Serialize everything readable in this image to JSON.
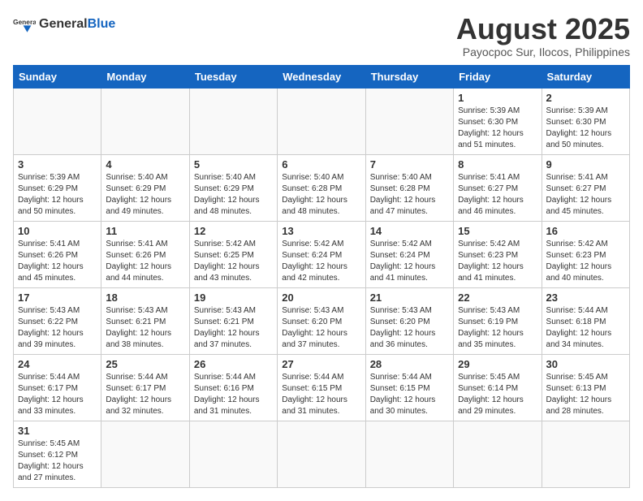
{
  "logo": {
    "text_general": "General",
    "text_blue": "Blue"
  },
  "title": "August 2025",
  "subtitle": "Payocpoc Sur, Ilocos, Philippines",
  "weekdays": [
    "Sunday",
    "Monday",
    "Tuesday",
    "Wednesday",
    "Thursday",
    "Friday",
    "Saturday"
  ],
  "weeks": [
    [
      {
        "day": "",
        "info": ""
      },
      {
        "day": "",
        "info": ""
      },
      {
        "day": "",
        "info": ""
      },
      {
        "day": "",
        "info": ""
      },
      {
        "day": "",
        "info": ""
      },
      {
        "day": "1",
        "info": "Sunrise: 5:39 AM\nSunset: 6:30 PM\nDaylight: 12 hours and 51 minutes."
      },
      {
        "day": "2",
        "info": "Sunrise: 5:39 AM\nSunset: 6:30 PM\nDaylight: 12 hours and 50 minutes."
      }
    ],
    [
      {
        "day": "3",
        "info": "Sunrise: 5:39 AM\nSunset: 6:29 PM\nDaylight: 12 hours and 50 minutes."
      },
      {
        "day": "4",
        "info": "Sunrise: 5:40 AM\nSunset: 6:29 PM\nDaylight: 12 hours and 49 minutes."
      },
      {
        "day": "5",
        "info": "Sunrise: 5:40 AM\nSunset: 6:29 PM\nDaylight: 12 hours and 48 minutes."
      },
      {
        "day": "6",
        "info": "Sunrise: 5:40 AM\nSunset: 6:28 PM\nDaylight: 12 hours and 48 minutes."
      },
      {
        "day": "7",
        "info": "Sunrise: 5:40 AM\nSunset: 6:28 PM\nDaylight: 12 hours and 47 minutes."
      },
      {
        "day": "8",
        "info": "Sunrise: 5:41 AM\nSunset: 6:27 PM\nDaylight: 12 hours and 46 minutes."
      },
      {
        "day": "9",
        "info": "Sunrise: 5:41 AM\nSunset: 6:27 PM\nDaylight: 12 hours and 45 minutes."
      }
    ],
    [
      {
        "day": "10",
        "info": "Sunrise: 5:41 AM\nSunset: 6:26 PM\nDaylight: 12 hours and 45 minutes."
      },
      {
        "day": "11",
        "info": "Sunrise: 5:41 AM\nSunset: 6:26 PM\nDaylight: 12 hours and 44 minutes."
      },
      {
        "day": "12",
        "info": "Sunrise: 5:42 AM\nSunset: 6:25 PM\nDaylight: 12 hours and 43 minutes."
      },
      {
        "day": "13",
        "info": "Sunrise: 5:42 AM\nSunset: 6:24 PM\nDaylight: 12 hours and 42 minutes."
      },
      {
        "day": "14",
        "info": "Sunrise: 5:42 AM\nSunset: 6:24 PM\nDaylight: 12 hours and 41 minutes."
      },
      {
        "day": "15",
        "info": "Sunrise: 5:42 AM\nSunset: 6:23 PM\nDaylight: 12 hours and 41 minutes."
      },
      {
        "day": "16",
        "info": "Sunrise: 5:42 AM\nSunset: 6:23 PM\nDaylight: 12 hours and 40 minutes."
      }
    ],
    [
      {
        "day": "17",
        "info": "Sunrise: 5:43 AM\nSunset: 6:22 PM\nDaylight: 12 hours and 39 minutes."
      },
      {
        "day": "18",
        "info": "Sunrise: 5:43 AM\nSunset: 6:21 PM\nDaylight: 12 hours and 38 minutes."
      },
      {
        "day": "19",
        "info": "Sunrise: 5:43 AM\nSunset: 6:21 PM\nDaylight: 12 hours and 37 minutes."
      },
      {
        "day": "20",
        "info": "Sunrise: 5:43 AM\nSunset: 6:20 PM\nDaylight: 12 hours and 37 minutes."
      },
      {
        "day": "21",
        "info": "Sunrise: 5:43 AM\nSunset: 6:20 PM\nDaylight: 12 hours and 36 minutes."
      },
      {
        "day": "22",
        "info": "Sunrise: 5:43 AM\nSunset: 6:19 PM\nDaylight: 12 hours and 35 minutes."
      },
      {
        "day": "23",
        "info": "Sunrise: 5:44 AM\nSunset: 6:18 PM\nDaylight: 12 hours and 34 minutes."
      }
    ],
    [
      {
        "day": "24",
        "info": "Sunrise: 5:44 AM\nSunset: 6:17 PM\nDaylight: 12 hours and 33 minutes."
      },
      {
        "day": "25",
        "info": "Sunrise: 5:44 AM\nSunset: 6:17 PM\nDaylight: 12 hours and 32 minutes."
      },
      {
        "day": "26",
        "info": "Sunrise: 5:44 AM\nSunset: 6:16 PM\nDaylight: 12 hours and 31 minutes."
      },
      {
        "day": "27",
        "info": "Sunrise: 5:44 AM\nSunset: 6:15 PM\nDaylight: 12 hours and 31 minutes."
      },
      {
        "day": "28",
        "info": "Sunrise: 5:44 AM\nSunset: 6:15 PM\nDaylight: 12 hours and 30 minutes."
      },
      {
        "day": "29",
        "info": "Sunrise: 5:45 AM\nSunset: 6:14 PM\nDaylight: 12 hours and 29 minutes."
      },
      {
        "day": "30",
        "info": "Sunrise: 5:45 AM\nSunset: 6:13 PM\nDaylight: 12 hours and 28 minutes."
      }
    ],
    [
      {
        "day": "31",
        "info": "Sunrise: 5:45 AM\nSunset: 6:12 PM\nDaylight: 12 hours and 27 minutes."
      },
      {
        "day": "",
        "info": ""
      },
      {
        "day": "",
        "info": ""
      },
      {
        "day": "",
        "info": ""
      },
      {
        "day": "",
        "info": ""
      },
      {
        "day": "",
        "info": ""
      },
      {
        "day": "",
        "info": ""
      }
    ]
  ]
}
